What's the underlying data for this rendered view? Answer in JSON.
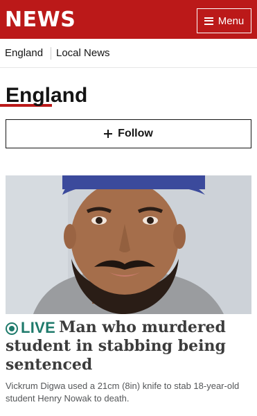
{
  "header": {
    "brand": "NEWS",
    "menu_label": "Menu",
    "menu_icon": "hamburger-icon",
    "accent_color": "#bb1919"
  },
  "subnav": {
    "items": [
      {
        "label": "England",
        "active": true
      },
      {
        "label": "Local News",
        "active": false
      }
    ]
  },
  "page": {
    "title": "England",
    "follow_label": "Follow",
    "follow_icon": "plus-icon"
  },
  "story": {
    "live_label": "LIVE",
    "live_icon": "live-indicator-icon",
    "live_color": "#1e7a6b",
    "headline": "Man who murdered student in stabbing being sentenced",
    "summary": "Vickrum Digwa used a 21cm (8in) knife to stab 18-year-old student Henry Nowak to death.",
    "image": "photo of a man wearing a blue turban"
  }
}
